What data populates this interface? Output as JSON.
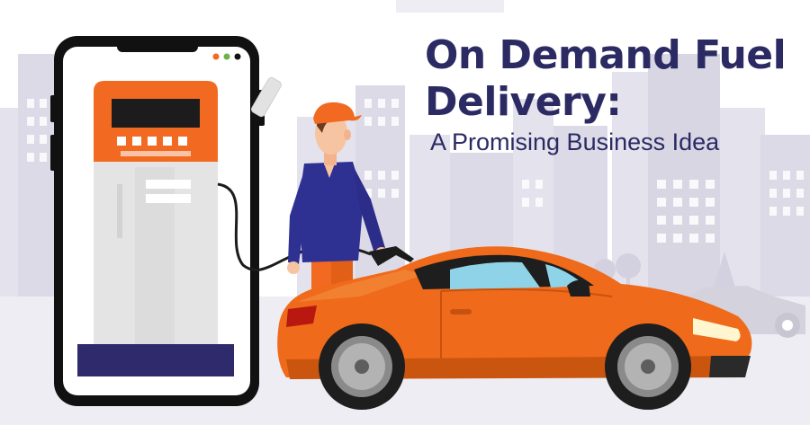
{
  "headline": {
    "line1": "On Demand Fuel",
    "line2": "Delivery:",
    "subtitle": "A Promising Business Idea"
  },
  "colors": {
    "title": "#2b2a63",
    "accent_orange": "#f26a21",
    "car_orange": "#ef6a1a",
    "phone_frame": "#111111",
    "city_buildings": "#e3e1ec",
    "pump_grey": "#e8e8e8",
    "pump_base": "#2e2a6b",
    "shirt_blue": "#2f3192"
  },
  "icons": {
    "fuel_pump": "fuel-pump-icon",
    "fuel_nozzle": "fuel-nozzle-icon"
  }
}
